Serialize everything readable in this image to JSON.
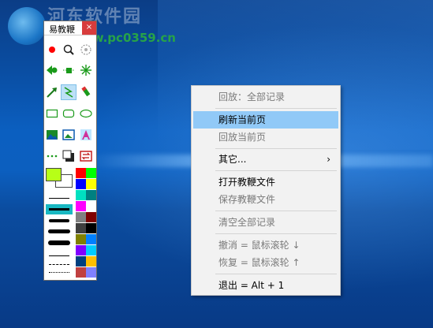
{
  "watermark": {
    "title": "河东软件园",
    "url": "www.pc0359.cn"
  },
  "toolbar_window": {
    "title": "易教鞭",
    "close_label": "×",
    "foreground_color": "#b7ff17",
    "background_color": "#ffffff",
    "tools": [
      "record-dot-icon",
      "magnifier-icon",
      "spotlight-icon",
      "arrow-dot-icon",
      "square-dot-icon",
      "star-burst-icon",
      "arrow-pen-icon",
      "lightning-icon",
      "marker-icon",
      "rectangle-icon",
      "rounded-rect-icon",
      "ellipse-icon",
      "image-icon",
      "image-frame-icon",
      "text-a-icon",
      "dots-icon",
      "window-shadow-icon",
      "swap-icon"
    ],
    "palette": [
      "#ff0000",
      "#00ff00",
      "#0000ff",
      "#ffff00",
      "#00e0c0",
      "#008080",
      "#ff00ff",
      "#ffffff",
      "#808080",
      "#800000",
      "#404040",
      "#000000",
      "#808000",
      "#0080ff",
      "#8000ff",
      "#00ccff",
      "#004080",
      "#ffbf00",
      "#c04040",
      "#8080ff"
    ]
  },
  "context_menu": {
    "items": [
      {
        "label": "回放：全部记录",
        "enabled": false
      },
      {
        "label": "刷新当前页",
        "enabled": true,
        "highlighted": true
      },
      {
        "label": "回放当前页",
        "enabled": false
      },
      {
        "label": "其它...",
        "enabled": true,
        "submenu_arrow": "›"
      },
      {
        "label": "打开教鞭文件",
        "enabled": true
      },
      {
        "label": "保存教鞭文件",
        "enabled": false
      },
      {
        "label": "清空全部记录",
        "enabled": false
      },
      {
        "label": "撤消 = 鼠标滚轮 ↓",
        "enabled": false
      },
      {
        "label": "恢复 = 鼠标滚轮 ↑",
        "enabled": false
      },
      {
        "label": "退出 = Alt + 1",
        "enabled": true
      }
    ]
  }
}
